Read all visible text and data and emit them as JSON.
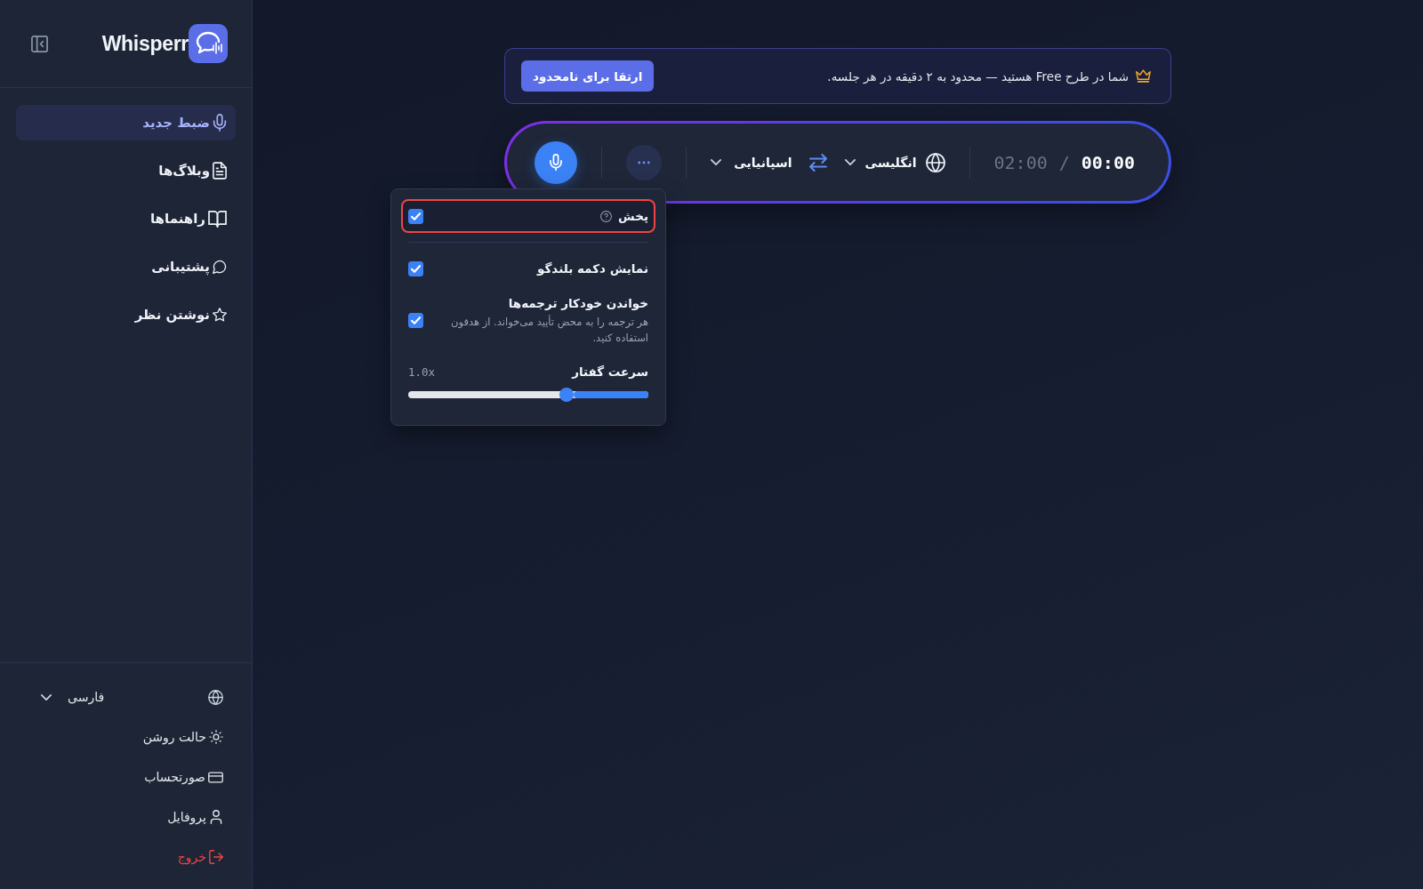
{
  "sidebar": {
    "brand": "Whisperr",
    "nav": [
      {
        "label": "ضبط جدید",
        "selected": true
      },
      {
        "label": "وبلاگ‌ها",
        "selected": false
      },
      {
        "label": "راهنماها",
        "selected": false
      },
      {
        "label": "پشتیبانی",
        "selected": false
      },
      {
        "label": "نوشتن نظر",
        "selected": false
      }
    ],
    "language": {
      "value": "فارسی"
    },
    "footer_items": [
      {
        "label": "حالت روشن",
        "kind": "link"
      },
      {
        "label": "صورتحساب",
        "kind": "link"
      },
      {
        "label": "پروفایل",
        "kind": "link"
      },
      {
        "label": "خروج",
        "kind": "danger"
      }
    ]
  },
  "banner": {
    "message": "شما در طرح Free هستید — محدود به ۲ دقیقه در هر جلسه.",
    "button": "ارتقا برای نامحدود"
  },
  "recorder": {
    "elapsed": "00:00",
    "separator": "/",
    "limit": "02:00",
    "source_language": "انگلیسی",
    "target_language": "اسپانیایی"
  },
  "menu": {
    "items": [
      {
        "kind": "checkbox",
        "label": "پخش",
        "help": true,
        "checked": true,
        "highlighted": true
      },
      {
        "kind": "checkbox",
        "label": "نمایش دکمه بلندگو",
        "help": false,
        "checked": true,
        "highlighted": false
      },
      {
        "kind": "checkbox",
        "label": "خواندن خودکار ترجمه‌ها",
        "description": "هر ترجمه را به محض تأیید می‌خواند. از هدفون استفاده کنید.",
        "help": false,
        "checked": true,
        "highlighted": false
      },
      {
        "kind": "slider",
        "label": "سرعت گفتار",
        "reading": "1.0x",
        "level": 0.34
      }
    ]
  }
}
